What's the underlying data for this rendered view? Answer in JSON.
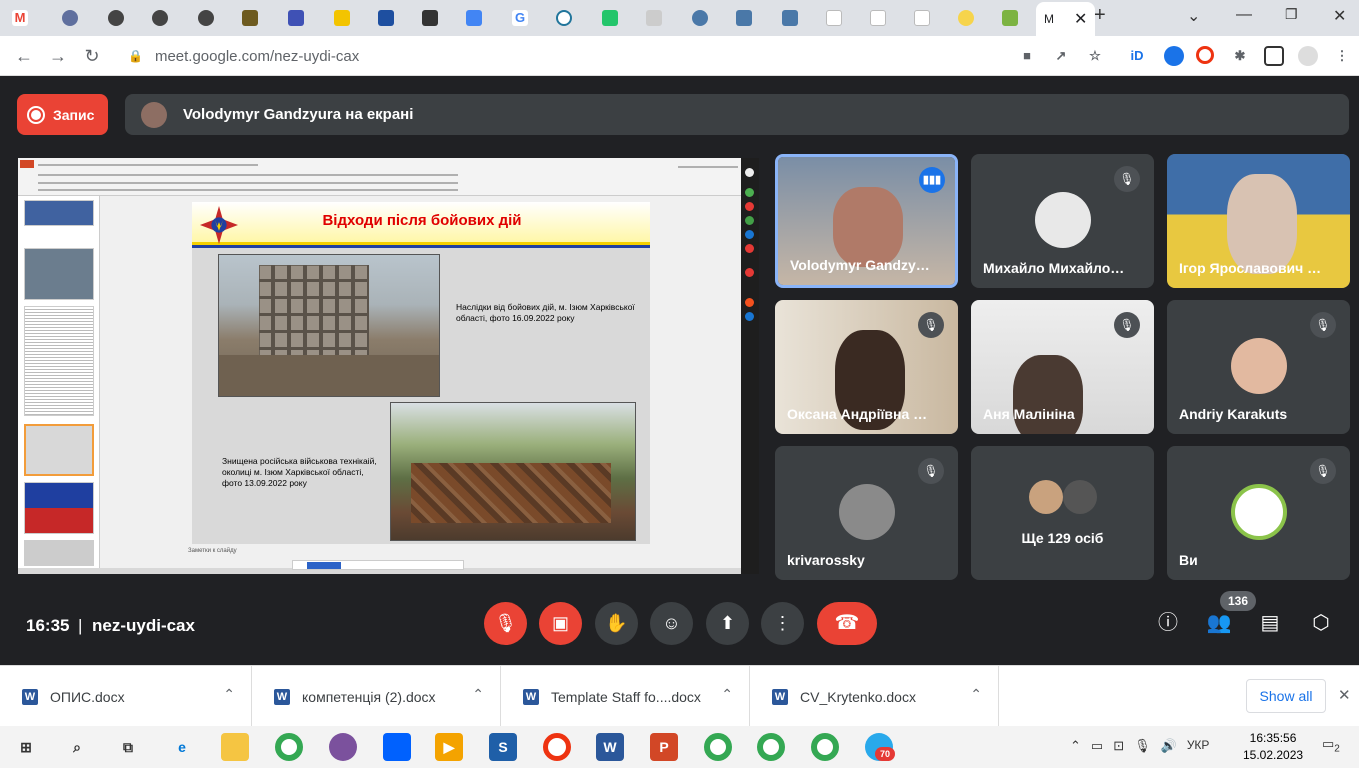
{
  "browser": {
    "active_tab_title": "M",
    "url": "meet.google.com/nez-uydi-cax",
    "window_controls": [
      "minimize-icon",
      "restore-icon",
      "close-icon"
    ]
  },
  "meet": {
    "record_label": "Запис",
    "presenter_banner": "Volodymyr Gandzyura на екрані",
    "time": "16:35",
    "separator": "|",
    "meeting_code": "nez-uydi-cax",
    "participant_count": "136",
    "participants": [
      {
        "name": "Volodymyr Gandzy…",
        "speaking": true
      },
      {
        "name": "Михайло Михайло…",
        "muted": true
      },
      {
        "name": "Ігор Ярославович …",
        "muted": false
      },
      {
        "name": "Оксана Андріївна …",
        "muted": true
      },
      {
        "name": "Аня Малініна",
        "muted": true
      },
      {
        "name": "Andriy Karakuts",
        "muted": true
      },
      {
        "name": "krivarossky",
        "muted": true
      },
      {
        "name": "Ще 129 осіб"
      },
      {
        "name": "Ви",
        "muted": true
      }
    ]
  },
  "slide": {
    "title": "Відходи після бойових дій",
    "caption1": "Наслідки від бойових дій, м. Ізюм Харківської області, фото 16.09.2022 року",
    "caption2": "Знищена російська військова технікаій, околиці м. Ізюм Харківської області, фото 13.09.2022 року",
    "notes": "Заметки к слайду"
  },
  "downloads": {
    "files": [
      "ОПИС.docx",
      "компетенція (2).docx",
      "Template Staff fo....docx",
      "CV_Krytenko.docx"
    ],
    "show_all": "Show all"
  },
  "taskbar": {
    "lang": "УКР",
    "time": "16:35:56",
    "date": "15.02.2023",
    "notifications": "2",
    "telegram_badge": "70"
  },
  "colors": {
    "meet_bg": "#202124",
    "tile_bg": "#3c4043",
    "red": "#ea4335",
    "accent": "#1a73e8"
  }
}
